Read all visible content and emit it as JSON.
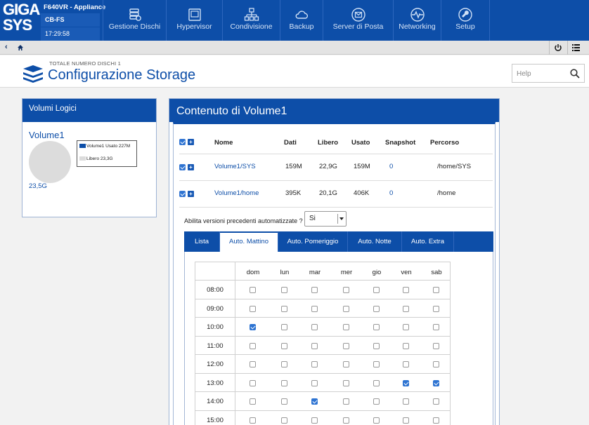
{
  "logo": {
    "line1": "GIGA",
    "line2": "SYS"
  },
  "appliance": {
    "name": "F640VR - Appliance",
    "host": "CB-FS",
    "time": "17:29:58"
  },
  "nav": [
    {
      "label": "Gestione Dischi",
      "icon": "disk-gear-icon"
    },
    {
      "label": "Hypervisor",
      "icon": "hypervisor-icon"
    },
    {
      "label": "Condivisione",
      "icon": "network-share-icon"
    },
    {
      "label": "Backup",
      "icon": "cloud-icon"
    },
    {
      "label": "Server di Posta",
      "icon": "mail-icon"
    },
    {
      "label": "Networking",
      "icon": "pulse-icon"
    },
    {
      "label": "Setup",
      "icon": "wrench-icon"
    }
  ],
  "subbar": {
    "back": "‹"
  },
  "header": {
    "subtitle": "TOTALE NUMERO DISCHI 1",
    "title": "Configurazione Storage",
    "help_placeholder": "Help"
  },
  "left_panel": {
    "title": "Volumi Logici",
    "volume_name": "Volume1",
    "legend_used": "Volume1 Usato 227M",
    "legend_free": "Libero 23,3G",
    "total": "23,5G",
    "colors": {
      "used": "#0d4ea8",
      "free": "#dcdcdc"
    }
  },
  "right_panel": {
    "title": "Contenuto di Volume1",
    "columns": [
      "Nome",
      "Dati",
      "Libero",
      "Usato",
      "Snapshot",
      "Percorso"
    ],
    "rows": [
      {
        "name": "Volume1/SYS",
        "dati": "159M",
        "libero": "22,9G",
        "usato": "159M",
        "snapshot": "0",
        "percorso": "/home/SYS"
      },
      {
        "name": "Volume1/home",
        "dati": "395K",
        "libero": "20,1G",
        "usato": "406K",
        "snapshot": "0",
        "percorso": "/home"
      }
    ],
    "abilita_label": "Abilita versioni precedenti automatizzate ?",
    "abilita_value": "Si",
    "tabs": [
      "Lista",
      "Auto. Mattino",
      "Auto. Pomeriggio",
      "Auto. Notte",
      "Auto. Extra"
    ],
    "active_tab": 1
  },
  "schedule": {
    "days": [
      "dom",
      "lun",
      "mar",
      "mer",
      "gio",
      "ven",
      "sab"
    ],
    "times": [
      "08:00",
      "09:00",
      "10:00",
      "11:00",
      "12:00",
      "13:00",
      "14:00",
      "15:00"
    ],
    "checked": {
      "10:00": [
        "dom"
      ],
      "13:00": [
        "ven",
        "sab"
      ],
      "14:00": [
        "mar"
      ]
    }
  },
  "colors": {
    "brand": "#0d4ea8",
    "check": "#2e74d2"
  }
}
